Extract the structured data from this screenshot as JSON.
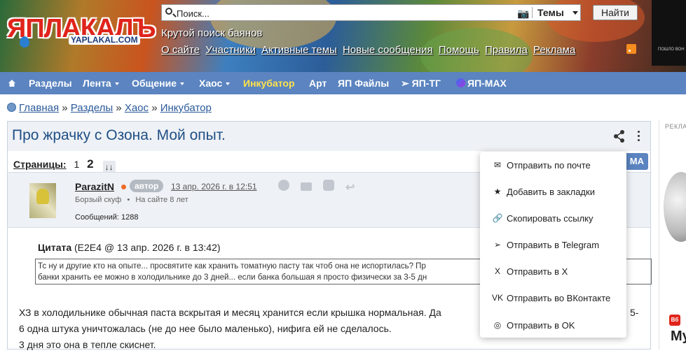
{
  "header": {
    "logo_text": "ЯПЛАКАЛЪ",
    "logo_domain": "YAPLAKAL.COM",
    "search_placeholder": "Поиск...",
    "search_scope": "Темы",
    "find_button": "Найти",
    "tagline": "Крутой поиск баянов",
    "links": [
      "О сайте",
      "Участники",
      "Активные темы",
      "Новые сообщения",
      "Помощь",
      "Правила",
      "Реклама"
    ]
  },
  "nav": {
    "items": [
      {
        "label": "Разделы"
      },
      {
        "label": "Лента"
      },
      {
        "label": "Общение"
      },
      {
        "label": "Хаос"
      },
      {
        "label": "Инкубатор"
      },
      {
        "label": "Арт"
      },
      {
        "label": "ЯП Файлы"
      },
      {
        "label": "ЯП-ТГ"
      },
      {
        "label": "ЯП-MAX"
      }
    ],
    "highlight_color": "#ffe24a"
  },
  "breadcrumb": [
    "Главная",
    "Разделы",
    "Хаос",
    "Инкубатор"
  ],
  "topic": {
    "title": "Про жрачку с Озона. Мой опыт.",
    "pages_label": "Страницы:",
    "pages": [
      "1",
      "2"
    ],
    "ma_button": "МА"
  },
  "post": {
    "username": "ParazitN",
    "author_badge": "автор",
    "date": "13 апр. 2026 г. в 12:51",
    "user_title": "Борзый скуф",
    "user_since": "На сайте 8 лет",
    "posts_count": "Сообщений: 1288",
    "quote_label": "Цитата",
    "quote_meta": "(E2E4 @ 13 апр. 2026 г. в 13:42)",
    "quote_line1": "Тс ну и другие кто на опыте... просвятите как хранить томатную пасту так чтоб она не испортилась? Пр",
    "quote_line2": "банки хранить ее можно в холодильнике до 3 дней... если банка большая я просто физически за 3-5 дн",
    "text_line1": "ХЗ в холодильнике обычная паста вскрытая и месяц хранится если крышка нормальная. Да",
    "text_line1_end": "5-",
    "text_line2": "6 одна штука уничтожалась (не до нее было маленько), нифига ей не сделалось.",
    "text_line3": "3 дня это она в тепле скиснет."
  },
  "share_menu": {
    "items": [
      {
        "icon": "mail-icon",
        "label": "Отправить по почте",
        "glyph": "✉"
      },
      {
        "icon": "star-icon",
        "label": "Добавить в закладки",
        "glyph": "★"
      },
      {
        "icon": "link-icon",
        "label": "Скопировать ссылку",
        "glyph": "🔗"
      },
      {
        "icon": "telegram-icon",
        "label": "Отправить в Telegram",
        "glyph": "➢"
      },
      {
        "icon": "x-icon",
        "label": "Отправить в X",
        "glyph": "X"
      },
      {
        "icon": "vk-icon",
        "label": "Отправить во ВКонтакте",
        "glyph": "VK"
      },
      {
        "icon": "ok-icon",
        "label": "Отправить в OK",
        "glyph": "◎"
      }
    ]
  },
  "ad": {
    "label": "РЕКЛА",
    "brand_short": "Му"
  },
  "colors": {
    "nav_bg": "#5b84c0",
    "link": "#2a5a9a",
    "title": "#1f4f86"
  }
}
